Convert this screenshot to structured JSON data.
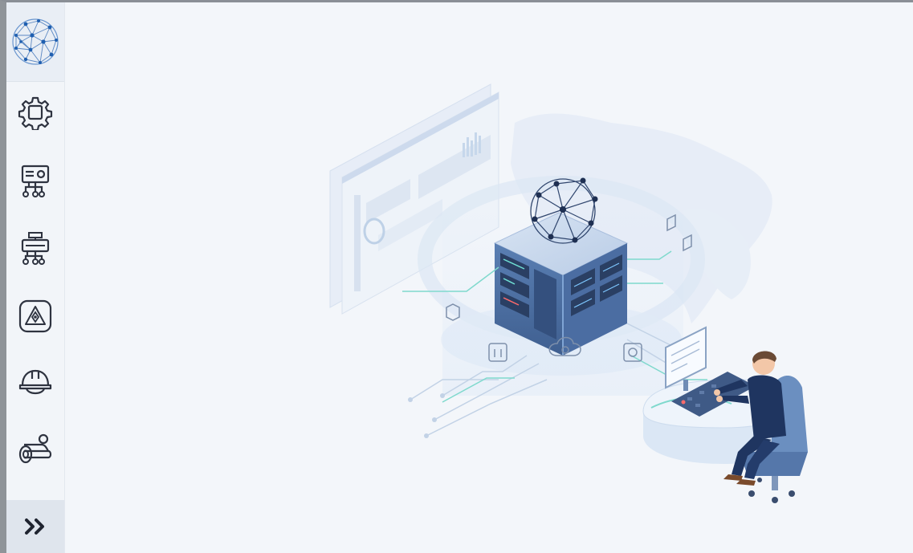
{
  "sidebar": {
    "logo": {
      "icon": "network-globe-icon"
    },
    "items": [
      {
        "icon": "gear-icon"
      },
      {
        "icon": "device-network-icon"
      },
      {
        "icon": "device-tree-icon"
      },
      {
        "icon": "warning-tag-icon"
      },
      {
        "icon": "hard-hat-icon"
      },
      {
        "icon": "pipeline-location-icon"
      }
    ],
    "expand": {
      "icon": "double-chevron-right-icon",
      "label": "»"
    }
  },
  "colors": {
    "icon_stroke": "#2e3340",
    "accent_blue": "#3f79c4",
    "panel_bg": "#f3f6fa"
  },
  "illustration": {
    "subject": "server-with-network-globe-and-operator-at-desk"
  }
}
